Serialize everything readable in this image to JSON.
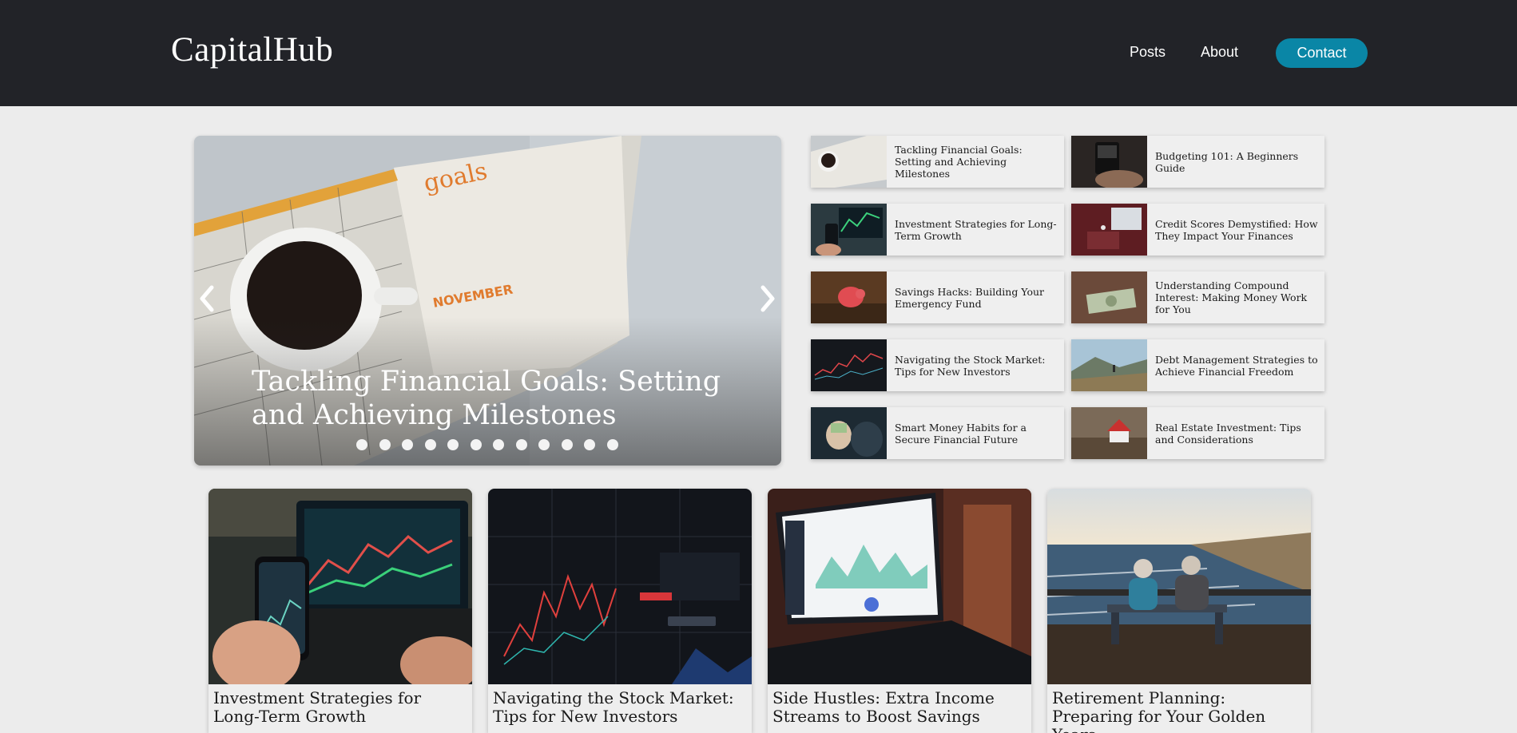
{
  "header": {
    "logo": "CapitalHub",
    "nav": {
      "posts": "Posts",
      "about": "About"
    },
    "contact_label": "Contact",
    "colors": {
      "background": "#222328",
      "contact_button": "#0a86a6"
    }
  },
  "hero": {
    "title": "Tackling Financial Goals: Setting and Achieving Milestones",
    "prev_icon": "chevron-left-icon",
    "next_icon": "chevron-right-icon",
    "slide_count": 12
  },
  "sidebar": {
    "items": [
      {
        "title": "Tackling Financial Goals: Setting and Achieving Milestones"
      },
      {
        "title": "Budgeting 101: A Beginners Guide"
      },
      {
        "title": "Investment Strategies for Long-Term Growth"
      },
      {
        "title": "Credit Scores Demystified: How They Impact Your Finances"
      },
      {
        "title": "Savings Hacks: Building Your Emergency Fund"
      },
      {
        "title": "Understanding Compound Interest: Making Money Work for You"
      },
      {
        "title": "Navigating the Stock Market: Tips for New Investors"
      },
      {
        "title": "Debt Management Strategies to Achieve Financial Freedom"
      },
      {
        "title": "Smart Money Habits for a Secure Financial Future"
      },
      {
        "title": "Real Estate Investment: Tips and Considerations"
      }
    ]
  },
  "cards": [
    {
      "title": "Investment Strategies for Long-Term Growth"
    },
    {
      "title": "Navigating the Stock Market: Tips for New Investors"
    },
    {
      "title": "Side Hustles: Extra Income Streams to Boost Savings"
    },
    {
      "title": "Retirement Planning: Preparing for Your Golden Years"
    }
  ]
}
